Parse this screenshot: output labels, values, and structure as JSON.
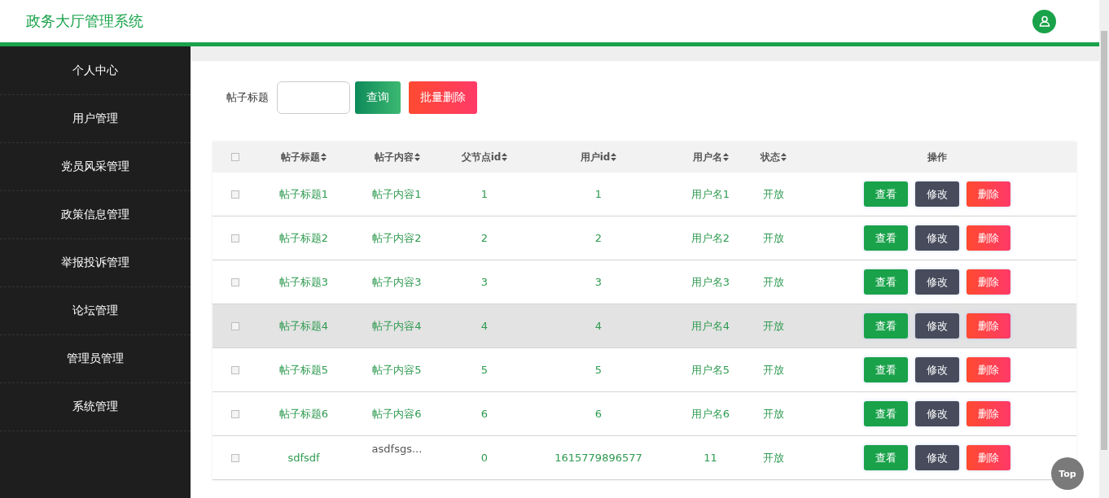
{
  "header": {
    "title": "政务大厅管理系统"
  },
  "sidebar": {
    "items": [
      {
        "label": "个人中心"
      },
      {
        "label": "用户管理"
      },
      {
        "label": "党员风采管理"
      },
      {
        "label": "政策信息管理"
      },
      {
        "label": "举报投诉管理"
      },
      {
        "label": "论坛管理"
      },
      {
        "label": "管理员管理"
      },
      {
        "label": "系统管理"
      }
    ]
  },
  "search": {
    "label": "帖子标题",
    "buttons": [
      {
        "label": "查询",
        "kind": "search"
      },
      {
        "label": "批量删除",
        "kind": "batch-delete"
      }
    ]
  },
  "table": {
    "select_all_checked": false,
    "columns": [
      {
        "label": "帖子标题",
        "sortable": true
      },
      {
        "label": "帖子内容",
        "sortable": true
      },
      {
        "label": "父节点id",
        "sortable": true
      },
      {
        "label": "用户id",
        "sortable": true
      },
      {
        "label": "用户名",
        "sortable": true
      },
      {
        "label": "状态",
        "sortable": true
      },
      {
        "label": "操作",
        "sortable": false
      }
    ],
    "rows": [
      {
        "cells": [
          "帖子标题1",
          "帖子内容1",
          "1",
          "1",
          "用户名1",
          "开放"
        ],
        "kind": "link",
        "hovered": false,
        "checked": false,
        "actions": [
          {
            "label": "查看",
            "kind": "view"
          },
          {
            "label": "修改",
            "kind": "edit"
          },
          {
            "label": "删除",
            "kind": "delete"
          }
        ]
      },
      {
        "cells": [
          "帖子标题2",
          "帖子内容2",
          "2",
          "2",
          "用户名2",
          "开放"
        ],
        "kind": "link",
        "hovered": false,
        "checked": false,
        "actions": [
          {
            "label": "查看",
            "kind": "view"
          },
          {
            "label": "修改",
            "kind": "edit"
          },
          {
            "label": "删除",
            "kind": "delete"
          }
        ]
      },
      {
        "cells": [
          "帖子标题3",
          "帖子内容3",
          "3",
          "3",
          "用户名3",
          "开放"
        ],
        "kind": "link",
        "hovered": false,
        "checked": false,
        "actions": [
          {
            "label": "查看",
            "kind": "view"
          },
          {
            "label": "修改",
            "kind": "edit"
          },
          {
            "label": "删除",
            "kind": "delete"
          }
        ]
      },
      {
        "cells": [
          "帖子标题4",
          "帖子内容4",
          "4",
          "4",
          "用户名4",
          "开放"
        ],
        "kind": "link",
        "hovered": true,
        "checked": false,
        "actions": [
          {
            "label": "查看",
            "kind": "view"
          },
          {
            "label": "修改",
            "kind": "edit"
          },
          {
            "label": "删除",
            "kind": "delete"
          }
        ]
      },
      {
        "cells": [
          "帖子标题5",
          "帖子内容5",
          "5",
          "5",
          "用户名5",
          "开放"
        ],
        "kind": "link",
        "hovered": false,
        "checked": false,
        "actions": [
          {
            "label": "查看",
            "kind": "view"
          },
          {
            "label": "修改",
            "kind": "edit"
          },
          {
            "label": "删除",
            "kind": "delete"
          }
        ]
      },
      {
        "cells": [
          "帖子标题6",
          "帖子内容6",
          "6",
          "6",
          "用户名6",
          "开放"
        ],
        "kind": "link",
        "hovered": false,
        "checked": false,
        "actions": [
          {
            "label": "查看",
            "kind": "view"
          },
          {
            "label": "修改",
            "kind": "edit"
          },
          {
            "label": "删除",
            "kind": "delete"
          }
        ]
      },
      {
        "cells": [
          "sdfsdf",
          "asdfsgs...",
          "0",
          "1615779896577",
          "11",
          "开放"
        ],
        "kind": "preview",
        "hovered": false,
        "checked": false,
        "actions": [
          {
            "label": "查看",
            "kind": "view"
          },
          {
            "label": "修改",
            "kind": "edit"
          },
          {
            "label": "删除",
            "kind": "delete"
          }
        ]
      }
    ]
  },
  "back_to_top": {
    "label": "Top"
  }
}
